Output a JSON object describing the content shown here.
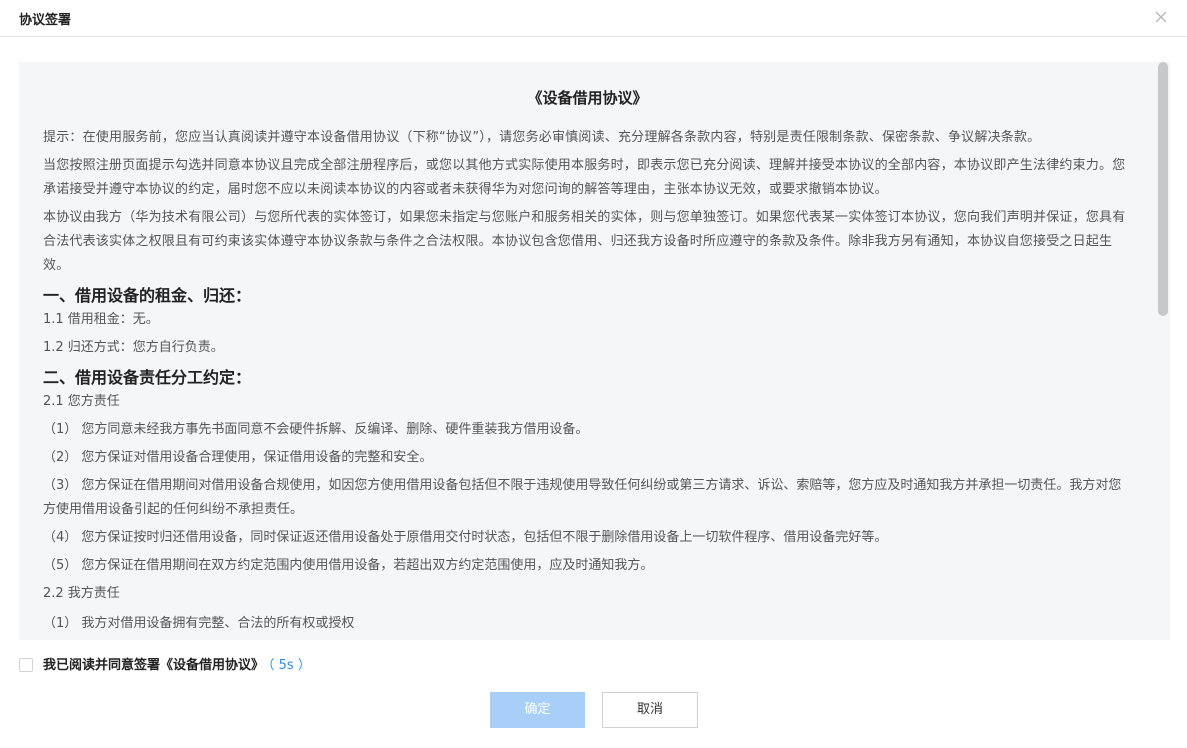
{
  "dialog": {
    "title": "协议签署"
  },
  "agreement": {
    "title": "《设备借用协议》",
    "intro": [
      "提示：在使用服务前，您应当认真阅读并遵守本设备借用协议（下称“协议”），请您务必审慎阅读、充分理解各条款内容，特别是责任限制条款、保密条款、争议解决条款。",
      "当您按照注册页面提示勾选并同意本协议且完成全部注册程序后，或您以其他方式实际使用本服务时，即表示您已充分阅读、理解并接受本协议的全部内容，本协议即产生法律约束力。您承诺接受并遵守本协议的约定，届时您不应以未阅读本协议的内容或者未获得华为对您问询的解答等理由，主张本协议无效，或要求撤销本协议。",
      "本协议由我方（华为技术有限公司）与您所代表的实体签订，如果您未指定与您账户和服务相关的实体，则与您单独签订。如果您代表某一实体签订本协议，您向我们声明并保证，您具有合法代表该实体之权限且有可约束该实体遵守本协议条款与条件之合法权限。本协议包含您借用、归还我方设备时所应遵守的条款及条件。除非我方另有通知，本协议自您接受之日起生效。"
    ],
    "section1": {
      "heading": "一、借用设备的租金、归还：",
      "items": [
        "1.1 借用租金：无。",
        "1.2 归还方式：您方自行负责。"
      ]
    },
    "section2": {
      "heading": "二、借用设备责任分工约定：",
      "sub1": "2.1 您方责任",
      "clauses": [
        "（1） 您方同意未经我方事先书面同意不会硬件拆解、反编译、删除、硬件重装我方借用设备。",
        "（2） 您方保证对借用设备合理使用，保证借用设备的完整和安全。",
        "（3） 您方保证在借用期间对借用设备合规使用，如因您方使用借用设备包括但不限于违规使用导致任何纠纷或第三方请求、诉讼、索赔等，您方应及时通知我方并承担一切责任。我方对您方使用借用设备引起的任何纠纷不承担责任。",
        "（4） 您方保证按时归还借用设备，同时保证返还借用设备处于原借用交付时状态，包括但不限于删除借用设备上一切软件程序、借用设备完好等。",
        "（5） 您方保证在借用期间在双方约定范围内使用借用设备，若超出双方约定范围使用，应及时通知我方。"
      ],
      "sub2": "2.2 我方责任",
      "sub2_clause_partial": "（1） 我方对借用设备拥有完整、合法的所有权或授权"
    }
  },
  "agree": {
    "label": "我已阅读并同意签署《设备借用协议》",
    "countdown": "（ 5s ）"
  },
  "buttons": {
    "confirm": "确定",
    "cancel": "取消"
  },
  "colors": {
    "accent": "#2f8df5",
    "confirm_disabled": "#a8cff8",
    "content_bg": "#f5f6f8"
  },
  "icons": {
    "close": "close-icon"
  }
}
